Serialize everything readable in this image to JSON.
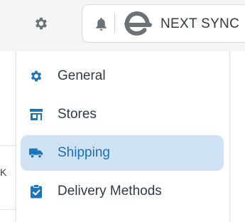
{
  "header": {
    "sync_label": "NEXT SYNC"
  },
  "background": {
    "fragment": "K"
  },
  "menu": {
    "items": [
      {
        "label": "General",
        "icon": "gear-icon",
        "active": false
      },
      {
        "label": "Stores",
        "icon": "store-icon",
        "active": false
      },
      {
        "label": "Shipping",
        "icon": "truck-icon",
        "active": true
      },
      {
        "label": "Delivery Methods",
        "icon": "clipboard-check-icon",
        "active": false
      }
    ]
  },
  "colors": {
    "accent": "#1b6fb3",
    "active_bg": "#cfe2f3",
    "icon": "#1f74b8"
  }
}
